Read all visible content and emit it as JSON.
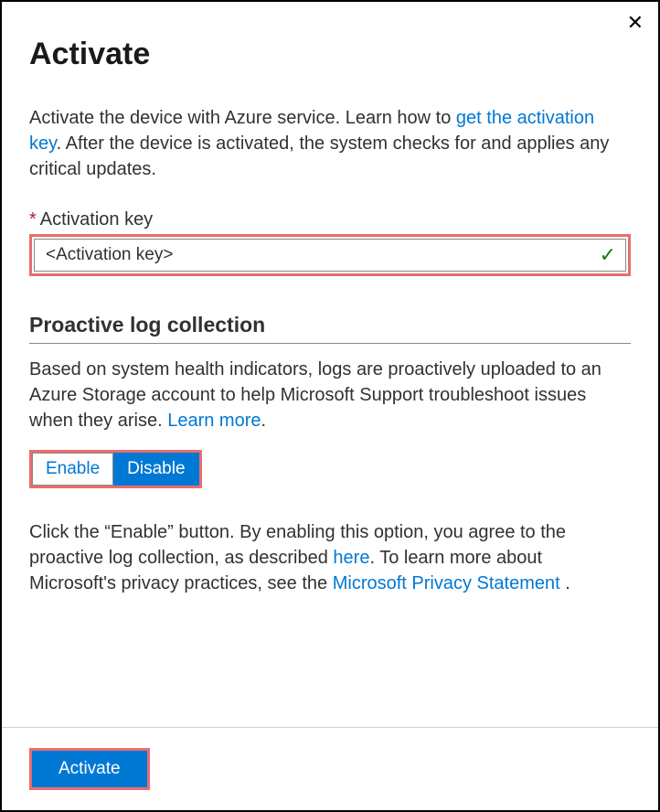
{
  "title": "Activate",
  "intro": {
    "part1": "Activate the device with Azure service. Learn how to ",
    "link1": "get the activation key",
    "part2": ". After the device is activated, the system checks for and applies any critical updates."
  },
  "field": {
    "label": "Activation key",
    "value": "<Activation key>"
  },
  "section": {
    "heading": "Proactive log collection",
    "desc_part1": "Based on system health indicators, logs are proactively uploaded to an Azure Storage account to help Microsoft Support troubleshoot issues when they arise. ",
    "desc_link": "Learn more",
    "desc_part2": ".",
    "toggle": {
      "enable": "Enable",
      "disable": "Disable",
      "selected": "disable"
    },
    "agree_part1": "Click the “Enable” button. By enabling this option, you agree to the proactive log collection, as described ",
    "agree_link1": "here",
    "agree_part2": ". To learn more about Microsoft's privacy practices, see the ",
    "agree_link2": "Microsoft Privacy Statement",
    "agree_part3": " ."
  },
  "footer": {
    "activate": "Activate"
  }
}
